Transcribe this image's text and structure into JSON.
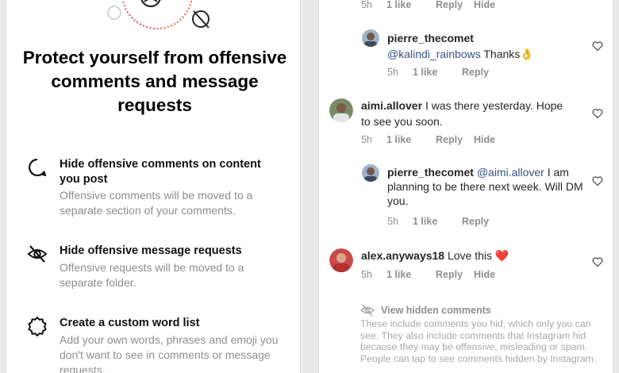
{
  "left": {
    "headline": "Protect yourself from offensive comments and message requests",
    "features": [
      {
        "icon": "comment-bubble-icon",
        "title": "Hide offensive comments on content you post",
        "description": "Offensive comments will be moved to a separate section of your comments."
      },
      {
        "icon": "eye-slash-icon",
        "title": "Hide offensive message requests",
        "description": "Offensive requests will be moved to a separate folder."
      },
      {
        "icon": "gear-icon",
        "title": "Create a custom word list",
        "description": "Add your own words, phrases and emoji you don't want to see in comments or message requests."
      }
    ]
  },
  "right": {
    "top_meta": {
      "time": "5h",
      "likes": "1 like",
      "reply": "Reply",
      "hide": "Hide"
    },
    "comments": [
      {
        "username": "pierre_thecomet",
        "mention": "@kalindi_rainbows",
        "text": "Thanks👌",
        "time": "5h",
        "likes": "1 like",
        "reply": "Reply"
      },
      {
        "username": "aimi.allover",
        "text": "I was there yesterday. Hope to see you soon.",
        "time": "5h",
        "likes": "1 like",
        "reply": "Reply",
        "hide": "Hide"
      },
      {
        "username": "pierre_thecomet",
        "mention": "@aimi.allover",
        "text": "I am planning to be there next week. Will DM you.",
        "time": "5h",
        "likes": "1 like",
        "reply": "Reply"
      },
      {
        "username": "alex.anyways18",
        "text": "Love this ❤️",
        "time": "5h",
        "likes": "1 like",
        "reply": "Reply",
        "hide": "Hide"
      }
    ],
    "hidden": {
      "link": "View hidden comments",
      "description": "These include comments you hid, which only you can see. They also include comments that Instagram hid because they may be offensive, misleading or spam. People can tap to see comments hidden by Instagram."
    }
  },
  "colors": {
    "text": "#262626",
    "secondary": "#8e8e8e",
    "mention": "#385185",
    "heart_red": "#ed4956",
    "ring_gradient": [
      "#f58529",
      "#dd2a7b",
      "#feda77"
    ]
  }
}
